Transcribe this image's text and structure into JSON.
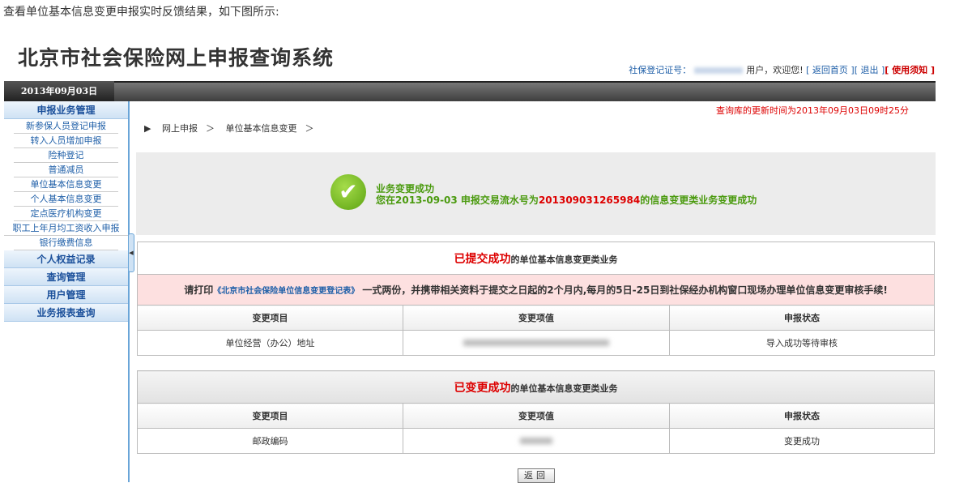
{
  "caption": "查看单位基本信息变更申报实时反馈结果，如下图所示:",
  "header": {
    "title": "北京市社会保险网上申报查询系统",
    "cert_label": "社保登记证号：",
    "welcome": "用户，欢迎您!",
    "home_link": "[ 返回首页 ]",
    "logout_link": "[ 退出 ]",
    "notice_link": "[ 使用须知 ]",
    "date": "2013年09月03日"
  },
  "sidebar": {
    "groups": [
      {
        "label": "申报业务管理",
        "items": [
          "新参保人员登记申报",
          "转入人员增加申报",
          "险种登记",
          "普通减员",
          "单位基本信息变更",
          "个人基本信息变更",
          "定点医疗机构变更",
          "职工上年月均工资收入申报",
          "银行缴费信息"
        ]
      },
      {
        "label": "个人权益记录"
      },
      {
        "label": "查询管理"
      },
      {
        "label": "用户管理"
      },
      {
        "label": "业务报表查询"
      }
    ]
  },
  "main": {
    "update_time": "查询库的更新时间为2013年09月03日09时25分",
    "breadcrumb": [
      "网上申报",
      "＞",
      "单位基本信息变更",
      "＞"
    ],
    "success": {
      "title": "业务变更成功",
      "msg_pre": "您在2013-09-03 申报交易流水号为",
      "serial": "201309031265984",
      "msg_post": "的信息变更类业务变更成功"
    },
    "table1": {
      "title_red": "已提交成功",
      "title_rest": "的单位基本信息变更类业务",
      "notice_pre": "请打印",
      "notice_link": "《北京市社会保险单位信息变更登记表》",
      "notice_post": " 一式两份，并携带相关资料于提交之日起的2个月内,每月的5日-25日到社保经办机构窗口现场办理单位信息变更审核手续!",
      "headers": [
        "变更项目",
        "变更项值",
        "申报状态"
      ],
      "rows": [
        {
          "item": "单位经营（办公）地址",
          "status": "导入成功等待审核"
        }
      ]
    },
    "table2": {
      "title_red": "已变更成功",
      "title_rest": "的单位基本信息变更类业务",
      "headers": [
        "变更项目",
        "变更项值",
        "申报状态"
      ],
      "rows": [
        {
          "item": "邮政编码",
          "status": "变更成功"
        }
      ]
    },
    "back_button": "返回"
  }
}
